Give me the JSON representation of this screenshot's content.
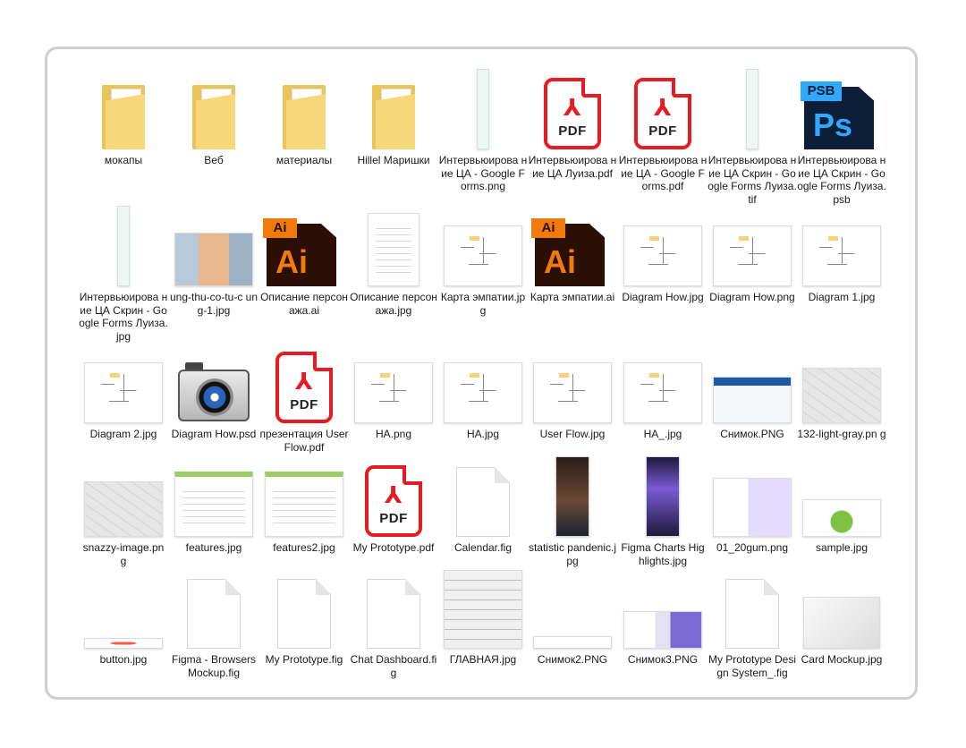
{
  "items": [
    {
      "label": "мокапы",
      "type": "folder"
    },
    {
      "label": "Веб",
      "type": "folder"
    },
    {
      "label": "материалы",
      "type": "folder"
    },
    {
      "label": "Hillel Маришки",
      "type": "folder"
    },
    {
      "label": "Интервьюирова ние ЦА - Google Forms.png",
      "type": "strip"
    },
    {
      "label": "Интервьюирова ние ЦА Луиза.pdf",
      "type": "pdf"
    },
    {
      "label": "Интервьюирова ние ЦА - Google Forms.pdf",
      "type": "pdf"
    },
    {
      "label": "Интервьюирова ние ЦА Скрин - Google Forms Луиза.tif",
      "type": "strip"
    },
    {
      "label": "Интервьюирова ние ЦА Скрин - Google Forms Луиза.psb",
      "type": "psb"
    },
    {
      "label": "Интервьюирова ние ЦА Скрин - Google Forms Луиза.jpg",
      "type": "strip"
    },
    {
      "label": "ung-thu-co-tu-c ung-1.jpg",
      "type": "photo"
    },
    {
      "label": "Описание персонажа.ai",
      "type": "ai"
    },
    {
      "label": "Описание персонажа.jpg",
      "type": "doc"
    },
    {
      "label": "Карта эмпатии.jpg",
      "type": "diagram"
    },
    {
      "label": "Карта эмпатии.ai",
      "type": "ai"
    },
    {
      "label": "Diagram How.jpg",
      "type": "diagram"
    },
    {
      "label": "Diagram How.png",
      "type": "diagram"
    },
    {
      "label": "Diagram 1.jpg",
      "type": "diagram"
    },
    {
      "label": "Diagram 2.jpg",
      "type": "diagram"
    },
    {
      "label": "Diagram How.psd",
      "type": "camera"
    },
    {
      "label": "презентация User Flow.pdf",
      "type": "pdf"
    },
    {
      "label": "HA.png",
      "type": "diagram"
    },
    {
      "label": "HA.jpg",
      "type": "diagram"
    },
    {
      "label": "User Flow.jpg",
      "type": "diagram"
    },
    {
      "label": "HA_.jpg",
      "type": "diagram"
    },
    {
      "label": "Снимок.PNG",
      "type": "screen"
    },
    {
      "label": "132-light-gray.pn g",
      "type": "map"
    },
    {
      "label": "snazzy-image.pn g",
      "type": "map"
    },
    {
      "label": "features.jpg",
      "type": "ui"
    },
    {
      "label": "features2.jpg",
      "type": "ui"
    },
    {
      "label": "My Prototype.pdf",
      "type": "pdf"
    },
    {
      "label": "Calendar.fig",
      "type": "blank"
    },
    {
      "label": "statistic pandenic.jpg",
      "type": "tall"
    },
    {
      "label": "Figma Charts Highlights.jpg",
      "type": "tall2"
    },
    {
      "label": "01_20gum.png",
      "type": "web"
    },
    {
      "label": "sample.jpg",
      "type": "sample"
    },
    {
      "label": "button.jpg",
      "type": "button"
    },
    {
      "label": "Figma - Browsers Mockup.fig",
      "type": "blank"
    },
    {
      "label": "My Prototype.fig",
      "type": "blank"
    },
    {
      "label": "Chat Dashboard.fig",
      "type": "blank"
    },
    {
      "label": "ГЛАВНАЯ.jpg",
      "type": "wire"
    },
    {
      "label": "Снимок2.PNG",
      "type": "thinbar"
    },
    {
      "label": "Снимок3.PNG",
      "type": "screen2"
    },
    {
      "label": "My Prototype Design System_.fig",
      "type": "blank"
    },
    {
      "label": "Card Mockup.jpg",
      "type": "card"
    }
  ],
  "icons": {
    "pdf_text": "PDF",
    "ai_tag": "Ai",
    "ai_big": "Ai",
    "psb_tag": "PSB",
    "ps_big": "Ps",
    "adobe_sym": "⅄"
  },
  "colors": {
    "pdf": "#e51c23",
    "ai": "#f07a0c",
    "ps": "#31a8ff",
    "folder": "#e8c45a"
  }
}
